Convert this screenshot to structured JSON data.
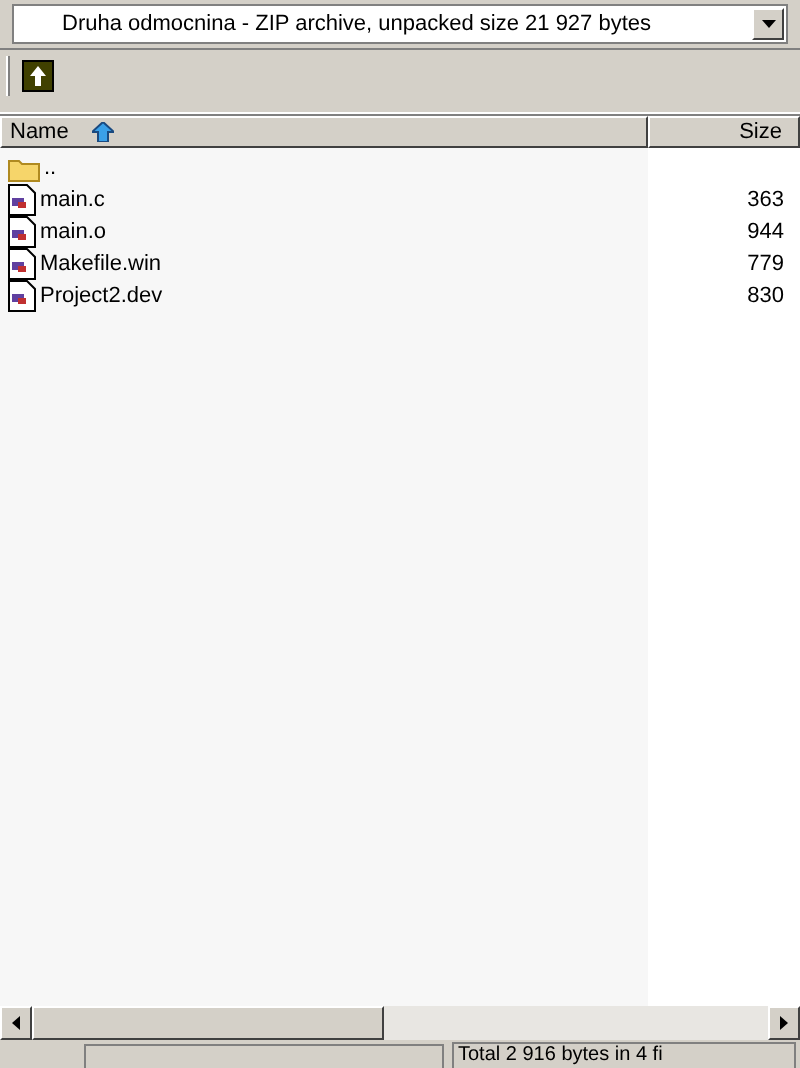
{
  "address": {
    "value": "Druha odmocnina - ZIP archive, unpacked size 21 927 bytes"
  },
  "columns": [
    {
      "label": "Name",
      "sorted": true
    },
    {
      "label": "Size",
      "sorted": false
    }
  ],
  "files": [
    {
      "name": "..",
      "kind": "folder"
    },
    {
      "name": "main.c",
      "size": "363",
      "kind": "file"
    },
    {
      "name": "main.o",
      "size": "944",
      "kind": "file"
    },
    {
      "name": "Makefile.win",
      "size": "779",
      "kind": "file"
    },
    {
      "name": "Project2.dev",
      "size": "830",
      "kind": "file"
    }
  ],
  "status_bar": {
    "text": "Total 2 916 bytes in 4 fi"
  }
}
